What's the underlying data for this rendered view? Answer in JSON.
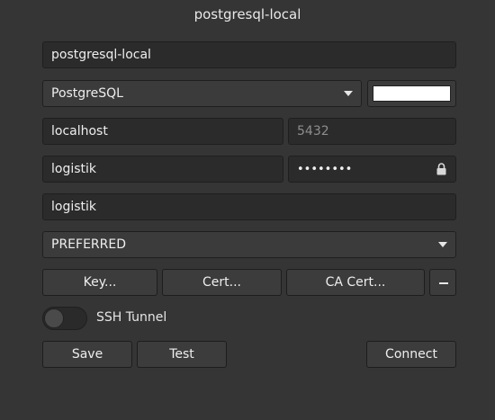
{
  "window": {
    "title": "postgresql-local"
  },
  "form": {
    "connection_name": "postgresql-local",
    "driver": "PostgreSQL",
    "color_value": "#ffffff",
    "host": "localhost",
    "port_placeholder": "5432",
    "user": "logistik",
    "password_masked": "••••••••",
    "database": "logistik",
    "ssl_mode": "PREFERRED"
  },
  "ssl_buttons": {
    "key": "Key...",
    "cert": "Cert...",
    "ca_cert": "CA Cert...",
    "remove": "–"
  },
  "ssh": {
    "label": "SSH Tunnel",
    "enabled": false
  },
  "actions": {
    "save": "Save",
    "test": "Test",
    "connect": "Connect"
  }
}
